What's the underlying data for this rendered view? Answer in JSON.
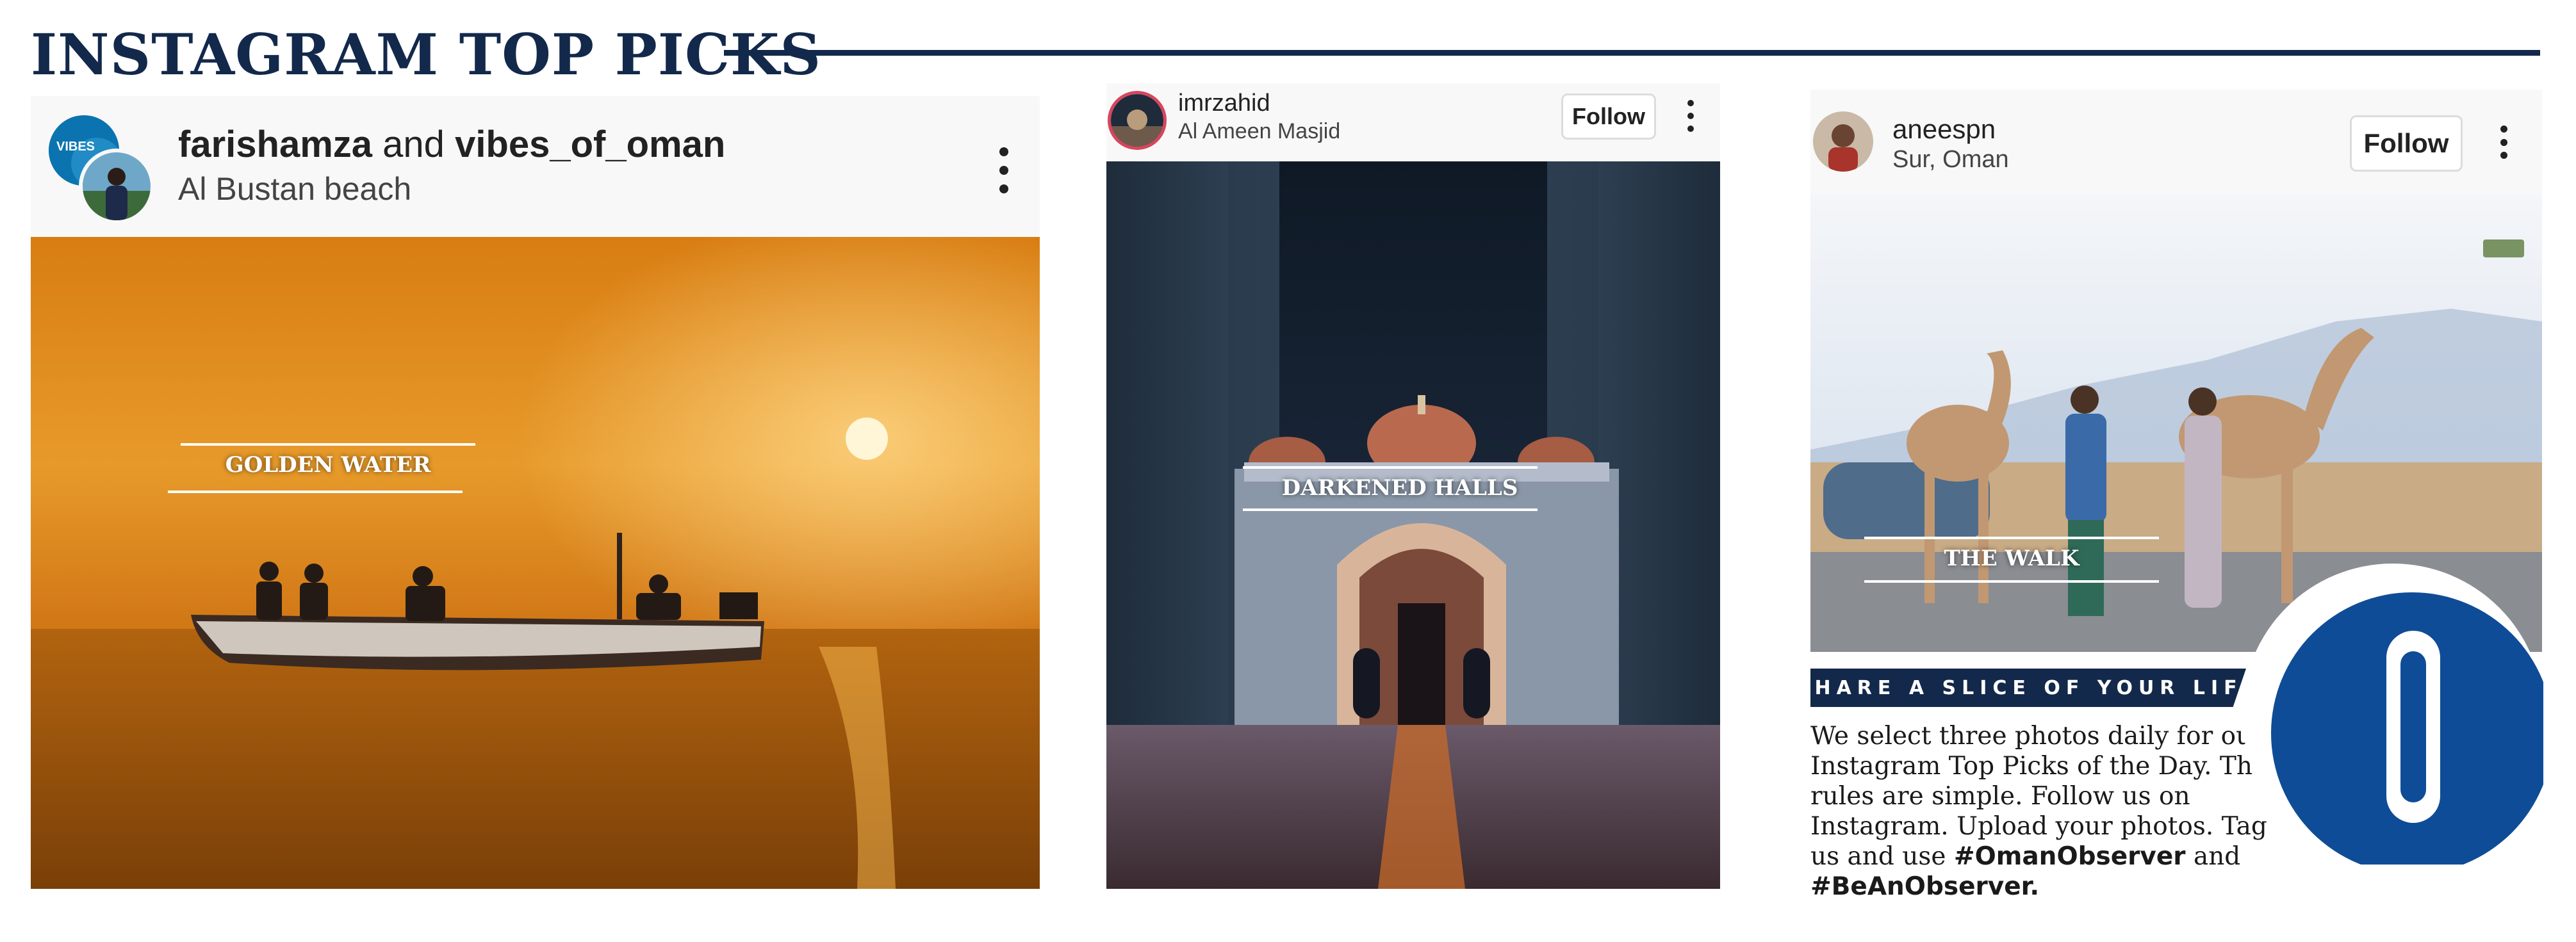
{
  "page": {
    "title": "INSTAGRAM TOP PICKS"
  },
  "posts": [
    {
      "user_primary": "farishamza",
      "user_joiner": "and",
      "user_secondary": "vibes_of_oman",
      "avatar_badge": "VIBES",
      "location": "Al Bustan beach",
      "caption": "GOLDEN WATER"
    },
    {
      "username": "imrzahid",
      "location": "Al Ameen Masjid",
      "follow_label": "Follow",
      "caption": "DARKENED HALLS"
    },
    {
      "username": "aneespn",
      "location": "Sur, Oman",
      "follow_label": "Follow",
      "caption": "THE WALK"
    }
  ],
  "share": {
    "banner": "SHARE A SLICE OF YOUR LIFE",
    "body": "We select three photos daily for our Instagram Top Picks of the Day. The rules are simple. Follow us on Instagram. Upload your photos. Tag us and use",
    "hashtag1": "#OmanObserver",
    "joiner": "and",
    "hashtag2": "#BeAnObserver."
  },
  "logo": {
    "letter": "O"
  },
  "colors": {
    "navy": "#13294b",
    "logo_blue": "#0f4c97",
    "sunset_orange": "#e08a1e",
    "night_blue": "#1d2a3d"
  }
}
